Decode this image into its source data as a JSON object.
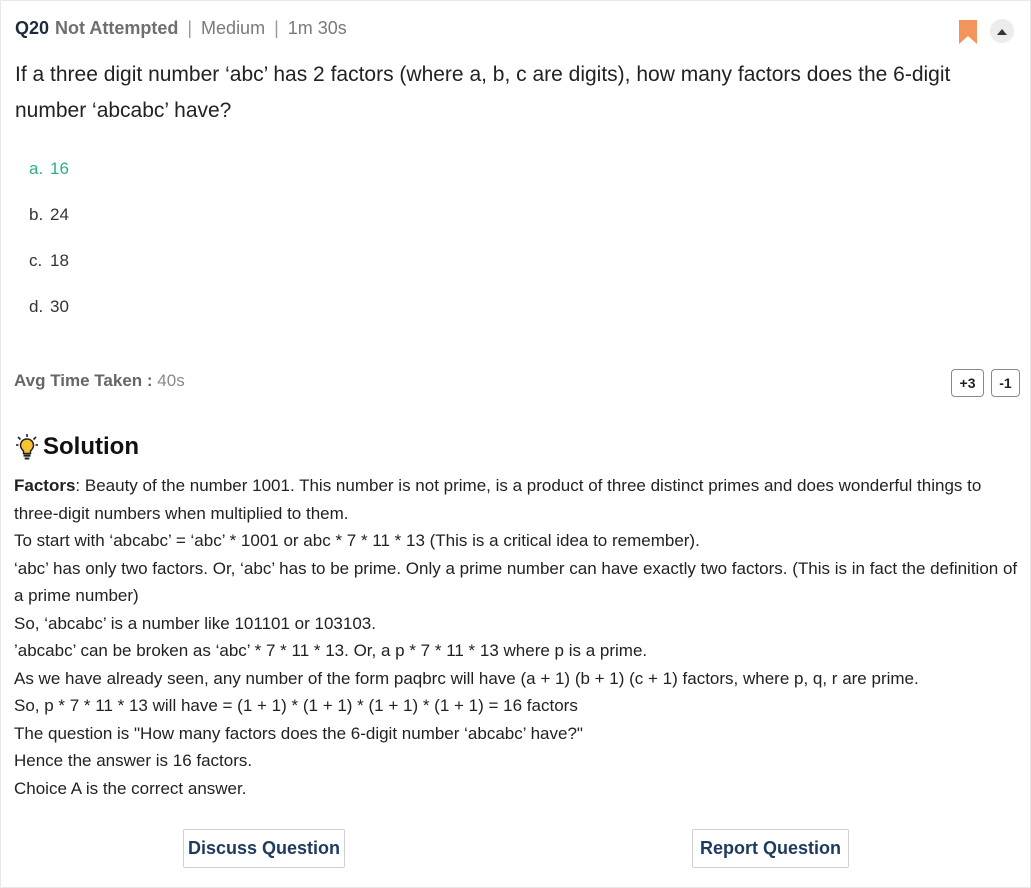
{
  "header": {
    "question_number": "Q20",
    "status": "Not Attempted",
    "separator": "|",
    "difficulty": "Medium",
    "time_limit": "1m 30s"
  },
  "question_text": "If a three digit number ‘abc’ has 2 factors (where a, b, c are digits), how many factors does the 6-digit number ‘abcabc’ have?",
  "options": [
    {
      "letter": "a.",
      "text": "16",
      "correct": true
    },
    {
      "letter": "b.",
      "text": "24",
      "correct": false
    },
    {
      "letter": "c.",
      "text": "18",
      "correct": false
    },
    {
      "letter": "d.",
      "text": "30",
      "correct": false
    }
  ],
  "avg_time": {
    "label": "Avg Time Taken :",
    "value": "40s"
  },
  "marks": {
    "positive": "+3",
    "negative": "-1"
  },
  "solution": {
    "title": "Solution",
    "intro_term": "Factors",
    "intro_rest": ": Beauty of the number 1001. This number is not prime, is a product of three distinct primes and does wonderful things to three-digit numbers when multiplied to them.",
    "lines": [
      "To start with ‘abcabc’ = ‘abc’ * 1001 or abc * 7 * 11 * 13 (This is a critical idea to remember).",
      "‘abc’ has only two factors. Or, ‘abc’ has to be prime. Only a prime number can have exactly two factors. (This is in fact the definition of a prime number)",
      "So, ‘abcabc’ is a number like 101101 or 103103.",
      "’abcabc’ can be broken as ‘abc’ * 7 * 11 * 13. Or, a p * 7 * 11 * 13 where p is a prime.",
      "As we have already seen, any number of the form paqbrc will have (a + 1) (b + 1) (c + 1) factors, where p, q, r are prime.",
      "So, p * 7 * 11 * 13 will have = (1 + 1) * (1 + 1) * (1 + 1) * (1 + 1) = 16 factors",
      "The question is \"How many factors does the 6-digit number ‘abcabc’ have?\"",
      "Hence the answer is 16 factors.",
      "Choice A is the correct answer."
    ]
  },
  "buttons": {
    "discuss": "Discuss Question",
    "report": "Report Question"
  },
  "colors": {
    "correct": "#2fae8a",
    "bookmark": "#f4945a",
    "button_text": "#1e3a5c"
  },
  "icons": {
    "bookmark": "bookmark-icon",
    "collapse": "chevron-up-icon",
    "solution": "lightbulb-icon"
  }
}
